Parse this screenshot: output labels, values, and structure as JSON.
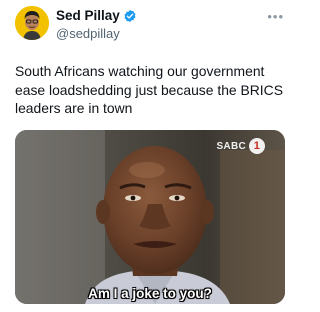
{
  "author": {
    "name": "Sed Pillay",
    "handle": "@sedpillay",
    "verified": true,
    "avatar_icon": "bitmoji-avatar",
    "avatar_bg": "#f2c200"
  },
  "more_icon": "more-horizontal-icon",
  "tweet": {
    "text": "South Africans watching our government ease loadshedding just because the BRICS leaders are in town"
  },
  "media": {
    "broadcaster_logo": "SABC",
    "broadcaster_number": "1",
    "caption": "Am I a joke to you?"
  },
  "colors": {
    "verified_blue": "#1d9bf0",
    "handle_gray": "#536471",
    "text": "#0f1419"
  }
}
